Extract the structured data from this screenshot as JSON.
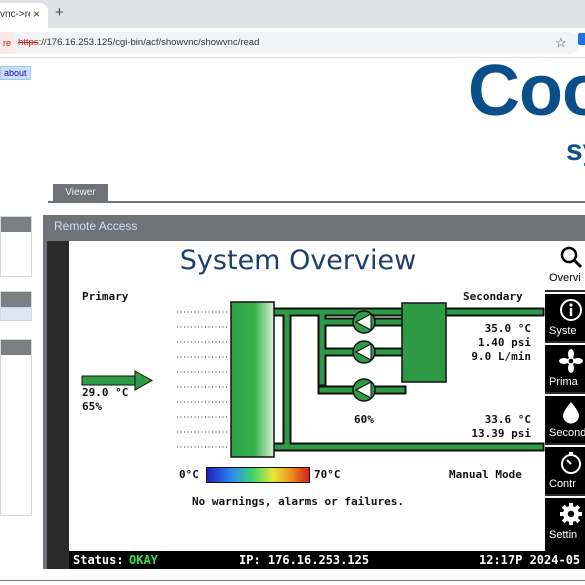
{
  "browser": {
    "tab_title": "vnc->re",
    "tab_close": "×",
    "new_tab": "+",
    "security_label": "re",
    "url_scheme": "https",
    "url_rest": "://176.16.253.125/cgi-bin/acf/showvnc/showvnc/read",
    "bookmark_star": "☆"
  },
  "page": {
    "about_link": "about",
    "logo_text": "Coo",
    "logo_subtext": "sy",
    "viewer_tab": "Viewer",
    "remote_access_title": "Remote Access"
  },
  "hmi": {
    "title": "System Overview",
    "primary_label": "Primary",
    "secondary_label": "Secondary",
    "primary_temp": "29.0 °C",
    "primary_percent": "65%",
    "secondary_supply_temp": "35.0 °C",
    "secondary_supply_pressure": "1.40 psi",
    "secondary_flow": "9.0 L/min",
    "secondary_return_temp": "33.6 °C",
    "secondary_return_pressure": "13.39 psi",
    "valve_position": "60%",
    "legend_min": "0°C",
    "legend_max": "70°C",
    "mode": "Manual Mode",
    "warnings": "No warnings, alarms or failures.",
    "colors": {
      "pipe_green": "#2f9a46",
      "title_blue": "#1e3f6e",
      "status_ok": "#2fe24f"
    }
  },
  "status_bar": {
    "status_label": "Status:",
    "status_value": "OKAY",
    "ip": "IP: 176.16.253.125",
    "datetime": "12:17P 2024-05"
  },
  "menu": [
    {
      "label": "Overvi",
      "icon": "search-icon"
    },
    {
      "label": "Syste",
      "icon": "info-icon"
    },
    {
      "label": "Prima",
      "icon": "fan-icon"
    },
    {
      "label": "Second",
      "icon": "droplet-icon"
    },
    {
      "label": "Contr",
      "icon": "timer-icon"
    },
    {
      "label": "Settin",
      "icon": "gear-icon"
    }
  ]
}
